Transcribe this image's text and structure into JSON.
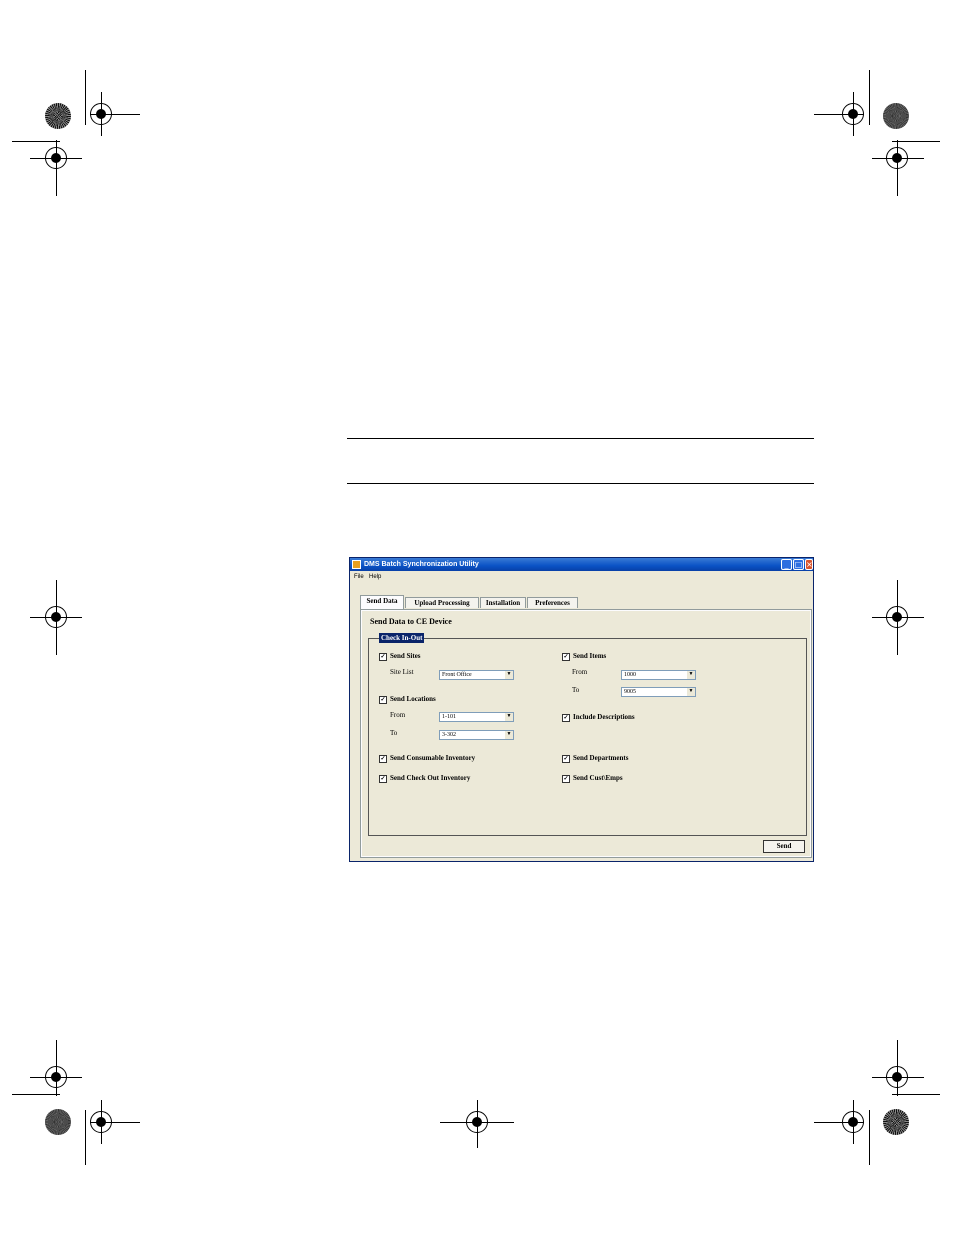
{
  "window": {
    "title": "DMS Batch Synchronization Utility",
    "menu": [
      "File",
      "Help"
    ]
  },
  "tabs": [
    "Send Data",
    "Upload Processing",
    "Installation",
    "Preferences"
  ],
  "active_tab": "Send Data",
  "panel": {
    "title": "Send Data to CE Device",
    "group_title": "Check In-Out",
    "send_sites": "Send Sites",
    "site_list_label": "Site List",
    "site_list_value": "Front Office",
    "send_locations": "Send Locations",
    "loc_from_label": "From",
    "loc_from_value": "1-101",
    "loc_to_label": "To",
    "loc_to_value": "3-302",
    "send_consumable": "Send Consumable Inventory",
    "send_checkout": "Send Check Out Inventory",
    "send_items": "Send Items",
    "item_from_label": "From",
    "item_from_value": "1000",
    "item_to_label": "To",
    "item_to_value": "9005",
    "include_descriptions": "Include Descriptions",
    "send_departments": "Send Departments",
    "send_custemps": "Send Cust\\Emps",
    "send_button": "Send"
  },
  "colors": {
    "titlebar": "#0a52c5",
    "window_bg": "#ece9d8",
    "legend_bg": "#0a246a"
  }
}
